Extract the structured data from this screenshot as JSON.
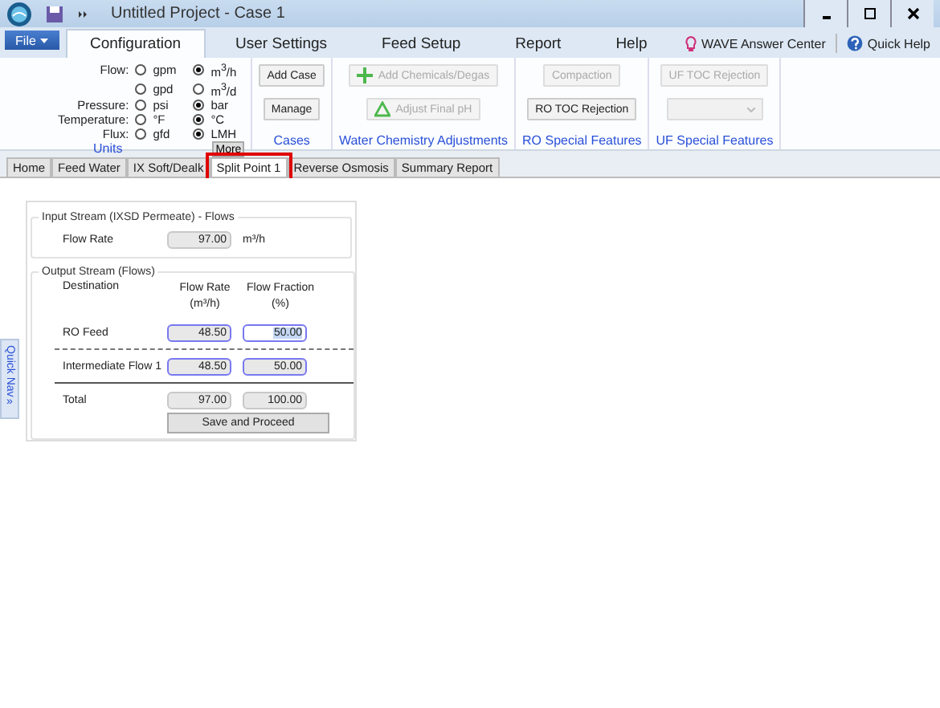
{
  "window": {
    "title": "Untitled Project - Case 1"
  },
  "menu": {
    "file": "File",
    "tabs": [
      {
        "label": "Configuration",
        "selected": true
      },
      {
        "label": "User Settings",
        "selected": false
      },
      {
        "label": "Feed Setup",
        "selected": false
      },
      {
        "label": "Report",
        "selected": false
      },
      {
        "label": "Help",
        "selected": false
      }
    ],
    "links": [
      {
        "label": "WAVE Answer Center",
        "kind": "bulb"
      },
      {
        "label": "Quick Help",
        "kind": "help"
      }
    ]
  },
  "ribbon": {
    "units": {
      "title": "Units",
      "more": "More",
      "rows": [
        {
          "label": "Flow:",
          "options": [
            {
              "text": "gpm",
              "selected": false
            },
            {
              "text": "m$^{3}$/h",
              "selected": true
            }
          ]
        },
        {
          "options": [
            {
              "text": "gpd",
              "selected": false
            },
            {
              "text": "m$^{3}$/d",
              "selected": false
            }
          ]
        },
        {
          "label": "Pressure:",
          "options": [
            {
              "text": "psi",
              "selected": false
            },
            {
              "text": "bar",
              "selected": true
            }
          ]
        },
        {
          "label": "Temperature:",
          "options": [
            {
              "text": "°F",
              "selected": false
            },
            {
              "text": "°C",
              "selected": true
            }
          ]
        },
        {
          "label": "Flux:",
          "options": [
            {
              "text": "gfd",
              "selected": false
            },
            {
              "text": "LMH",
              "selected": true
            }
          ]
        }
      ]
    },
    "groups": [
      {
        "title": "Cases",
        "buttons": [
          {
            "kind": "text",
            "label": "Add Case",
            "disabled": false
          },
          {
            "kind": "text",
            "label": "Manage",
            "disabled": false
          }
        ]
      },
      {
        "title": "Water Chemistry Adjustments",
        "buttons": [
          {
            "kind": "plus",
            "label": "Add Chemicals/Degas",
            "disabled": true
          },
          {
            "kind": "triangle",
            "label": "Adjust Final pH",
            "disabled": true
          }
        ]
      },
      {
        "title": "RO Special Features",
        "buttons": [
          {
            "kind": "text",
            "label": "Compaction",
            "disabled": true
          },
          {
            "kind": "text",
            "label": "RO TOC Rejection",
            "disabled": false
          }
        ]
      },
      {
        "title": "UF Special Features",
        "buttons": [
          {
            "kind": "text",
            "label": "UF TOC Rejection",
            "disabled": true
          },
          {
            "kind": "dropdown",
            "disabled": true
          }
        ]
      }
    ]
  },
  "page_tabs": [
    {
      "label": "Home",
      "selected": false,
      "highlighted": false
    },
    {
      "label": "Feed Water",
      "selected": false,
      "highlighted": false
    },
    {
      "label": "IX Soft/Dealk",
      "selected": false,
      "highlighted": false
    },
    {
      "label": "Split Point 1",
      "selected": true,
      "highlighted": true
    },
    {
      "label": "Reverse Osmosis",
      "selected": false,
      "highlighted": false
    },
    {
      "label": "Summary Report",
      "selected": false,
      "highlighted": false
    }
  ],
  "quick_nav": {
    "label": "Quick Nav",
    "icon": "»"
  },
  "input_stream": {
    "title": "Input Stream (IXSD Permeate) - Flows",
    "label": "Flow Rate",
    "value": "97.00",
    "unit": "m³/h"
  },
  "output_stream": {
    "title": "Output Stream (Flows)",
    "columns": [
      {
        "label": "Destination"
      },
      {
        "label": "Flow Rate",
        "unit": "(m³/h)"
      },
      {
        "label": "Flow Fraction",
        "unit": "(%)"
      }
    ],
    "rows": [
      {
        "name": "RO Feed",
        "flow_rate": "48.50",
        "fraction": "50.00",
        "editable": true,
        "focused": true,
        "dashed_rule_below": true,
        "solid_rule_below": false
      },
      {
        "name": "Intermediate Flow 1",
        "flow_rate": "48.50",
        "fraction": "50.00",
        "editable": true,
        "focused": false,
        "dashed_rule_below": false,
        "solid_rule_below": true
      },
      {
        "name": "Total",
        "flow_rate": "97.00",
        "fraction": "100.00",
        "editable": false,
        "focused": false,
        "dashed_rule_below": false,
        "solid_rule_below": false
      }
    ],
    "save_button": "Save and Proceed"
  }
}
